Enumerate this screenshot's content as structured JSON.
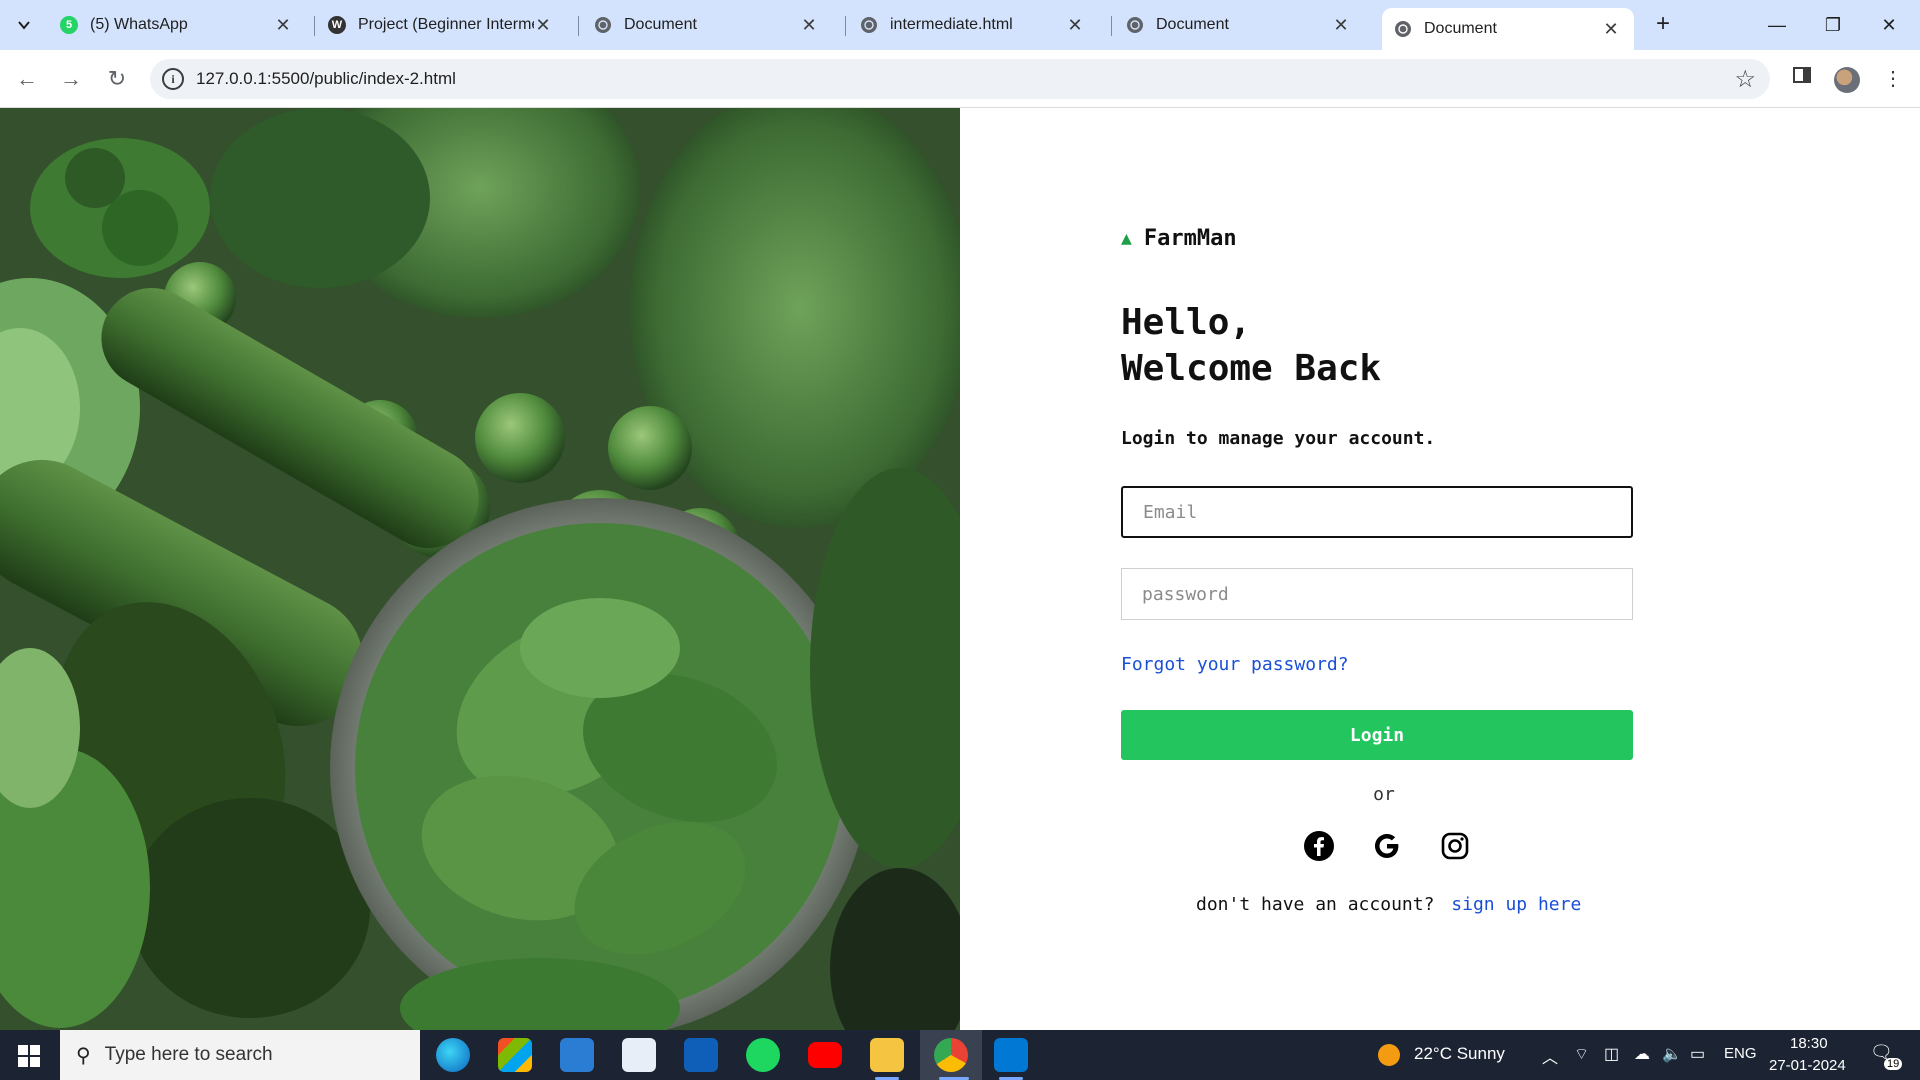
{
  "browser": {
    "tabs": [
      {
        "title": "(5) WhatsApp",
        "favicon": "whatsapp-icon"
      },
      {
        "title": "Project (Beginner Intermed",
        "favicon": "wordpress-icon"
      },
      {
        "title": "Document",
        "favicon": "globe-icon"
      },
      {
        "title": "intermediate.html",
        "favicon": "globe-icon"
      },
      {
        "title": "Document",
        "favicon": "globe-icon"
      },
      {
        "title": "Document",
        "favicon": "globe-icon",
        "active": true
      }
    ],
    "url": "127.0.0.1:5500/public/index-2.html"
  },
  "login": {
    "brand": "FarmMan",
    "heading_line1": "Hello,",
    "heading_line2": "Welcome Back",
    "subtitle": "Login to manage your account.",
    "email_placeholder": "Email",
    "password_placeholder": "password",
    "forgot_link": "Forgot your password?",
    "login_button": "Login",
    "or_text": "or",
    "social": [
      "facebook-icon",
      "google-icon",
      "instagram-icon"
    ],
    "signup_prompt": "don't have an account?",
    "signup_link": "sign up here",
    "accent_color": "#22c55e",
    "link_color": "#1a4fd6"
  },
  "taskbar": {
    "search_placeholder": "Type here to search",
    "weather": "22°C  Sunny",
    "language": "ENG",
    "time": "18:30",
    "date": "27-01-2024",
    "notifications": "19"
  }
}
